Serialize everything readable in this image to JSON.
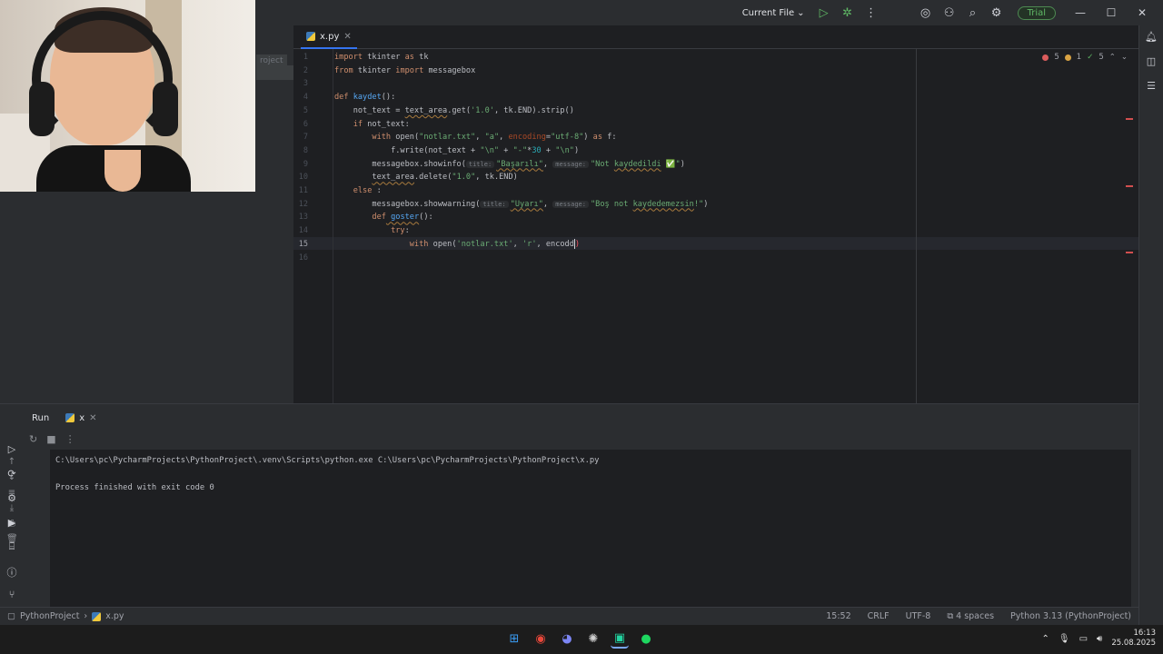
{
  "titlebar": {
    "run_config": "Current File",
    "trial_label": "Trial"
  },
  "project_panel": {
    "label": "roject"
  },
  "editor": {
    "tab_name": "x.py",
    "inspections": {
      "errors": "5",
      "warnings": "1",
      "ok": "5"
    },
    "line_numbers": [
      "1",
      "2",
      "3",
      "4",
      "5",
      "6",
      "7",
      "8",
      "9",
      "10",
      "11",
      "12",
      "13",
      "14",
      "15",
      "16"
    ],
    "hints": {
      "title": "title:",
      "message": "message:"
    },
    "code": {
      "l1_kw1": "import",
      "l1_rest": " tkinter ",
      "l1_kw2": "as",
      "l1_tail": " tk",
      "l2_kw1": "from",
      "l2_rest": " tkinter ",
      "l2_kw2": "import",
      "l2_tail": " messagebox",
      "l4_kw": "def",
      "l4_fn": " kaydet",
      "l4_tail": "():",
      "l5_a": "    not_text = ",
      "l5_b": "text_area",
      "l5_c": ".get(",
      "l5_d": "'1.0'",
      "l5_e": ", tk.END).strip()",
      "l6_kw": "    if",
      "l6_tail": " not_text:",
      "l7_kw": "        with",
      "l7_a": " open(",
      "l7_s1": "\"notlar.txt\"",
      "l7_c": ", ",
      "l7_s2": "\"a\"",
      "l7_d": ", ",
      "l7_p": "encoding",
      "l7_e": "=",
      "l7_s3": "\"utf-8\"",
      "l7_f": ") ",
      "l7_kw2": "as",
      "l7_g": " f:",
      "l8_a": "            f.write(not_text + ",
      "l8_s1": "\"\\n\"",
      "l8_b": " + ",
      "l8_s2": "\"-\"",
      "l8_c": "*",
      "l8_n": "30",
      "l8_d": " + ",
      "l8_s3": "\"\\n\"",
      "l8_e": ")",
      "l9_a": "        messagebox.showinfo(",
      "l9_s1": "\"Başarılı\"",
      "l9_b": ", ",
      "l9_s2a": "\"Not ",
      "l9_s2b": "kaydedildi",
      "l9_s2c": " ✅\"",
      "l9_c": ")",
      "l10_a": "        ",
      "l10_b": "text_area",
      "l10_c": ".delete(",
      "l10_s": "\"1.0\"",
      "l10_d": ", tk.END)",
      "l11_kw": "    else",
      "l11_tail": " :",
      "l12_a": "        messagebox.showwarning(",
      "l12_s1": "\"Uyarı\"",
      "l12_b": ", ",
      "l12_s2a": "\"Boş not ",
      "l12_s2b": "kaydedemezsin",
      "l12_s2c": "!\"",
      "l12_c": ")",
      "l13_kw": "        def",
      "l13_fn": " goster",
      "l13_tail": "():",
      "l14_kw": "            try",
      "l14_tail": ":",
      "l15_kw": "                with",
      "l15_a": " open(",
      "l15_s1": "'notlar.txt'",
      "l15_b": ", ",
      "l15_s2": "'r'",
      "l15_c": ", encodd",
      "l15_d": ")"
    }
  },
  "run_panel": {
    "title": "Run",
    "tab_name": "x",
    "console": [
      "C:\\Users\\pc\\PycharmProjects\\PythonProject\\.venv\\Scripts\\python.exe C:\\Users\\pc\\PycharmProjects\\PythonProject\\x.py",
      "",
      "Process finished with exit code 0"
    ]
  },
  "statusbar": {
    "project": "PythonProject",
    "file": "x.py",
    "position": "15:52",
    "line_sep": "CRLF",
    "encoding": "UTF-8",
    "indent": "4 spaces",
    "interpreter": "Python 3.13 (PythonProject)"
  },
  "taskbar": {
    "time": "16:13",
    "date": "25.08.2025"
  },
  "colors": {
    "accent": "#3574f0",
    "keyword": "#cf8e6d",
    "string": "#6aab73",
    "function": "#56a8f5",
    "error": "#db5c5c"
  }
}
